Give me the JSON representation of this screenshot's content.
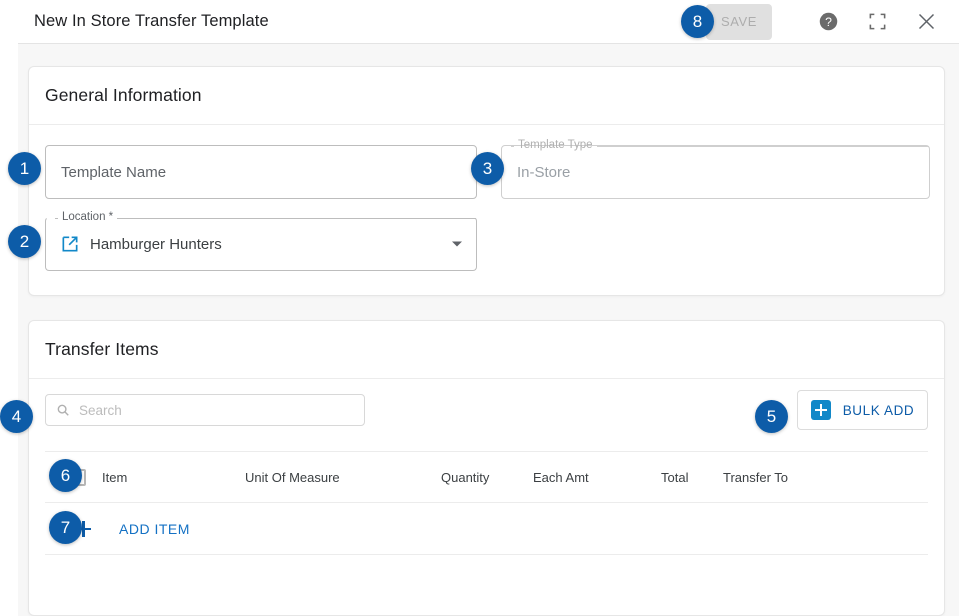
{
  "window": {
    "title": "New In Store Transfer Template",
    "save_label": "SAVE",
    "help_icon": "help-circle-icon",
    "fullscreen_icon": "fullscreen-icon",
    "close_icon": "close-icon"
  },
  "general": {
    "title": "General Information",
    "template_name": {
      "placeholder": "Template Name",
      "value": ""
    },
    "template_type": {
      "label": "Template Type",
      "value": "In-Store"
    },
    "location": {
      "label": "Location *",
      "value": "Hamburger Hunters",
      "link_icon": "external-link-icon",
      "chevron_icon": "chevron-down-icon"
    }
  },
  "transfer_items": {
    "title": "Transfer Items",
    "search": {
      "placeholder": "Search",
      "value": "",
      "icon": "search-icon"
    },
    "bulk_add_label": "BULK ADD",
    "bulk_add_icon": "plus-square-icon",
    "columns": [
      "Item",
      "Unit Of Measure",
      "Quantity",
      "Each Amt",
      "Total",
      "Transfer To"
    ],
    "add_item_label": "ADD ITEM",
    "add_item_icon": "plus-icon"
  },
  "badges": [
    {
      "n": "1"
    },
    {
      "n": "2"
    },
    {
      "n": "3"
    },
    {
      "n": "4"
    },
    {
      "n": "5"
    },
    {
      "n": "6"
    },
    {
      "n": "7"
    },
    {
      "n": "8"
    }
  ],
  "colors": {
    "badge_blue": "#0d5ca8",
    "accent_teal": "#1288c8",
    "link_blue": "#1471c4",
    "page_bg": "#f7f7f7"
  }
}
